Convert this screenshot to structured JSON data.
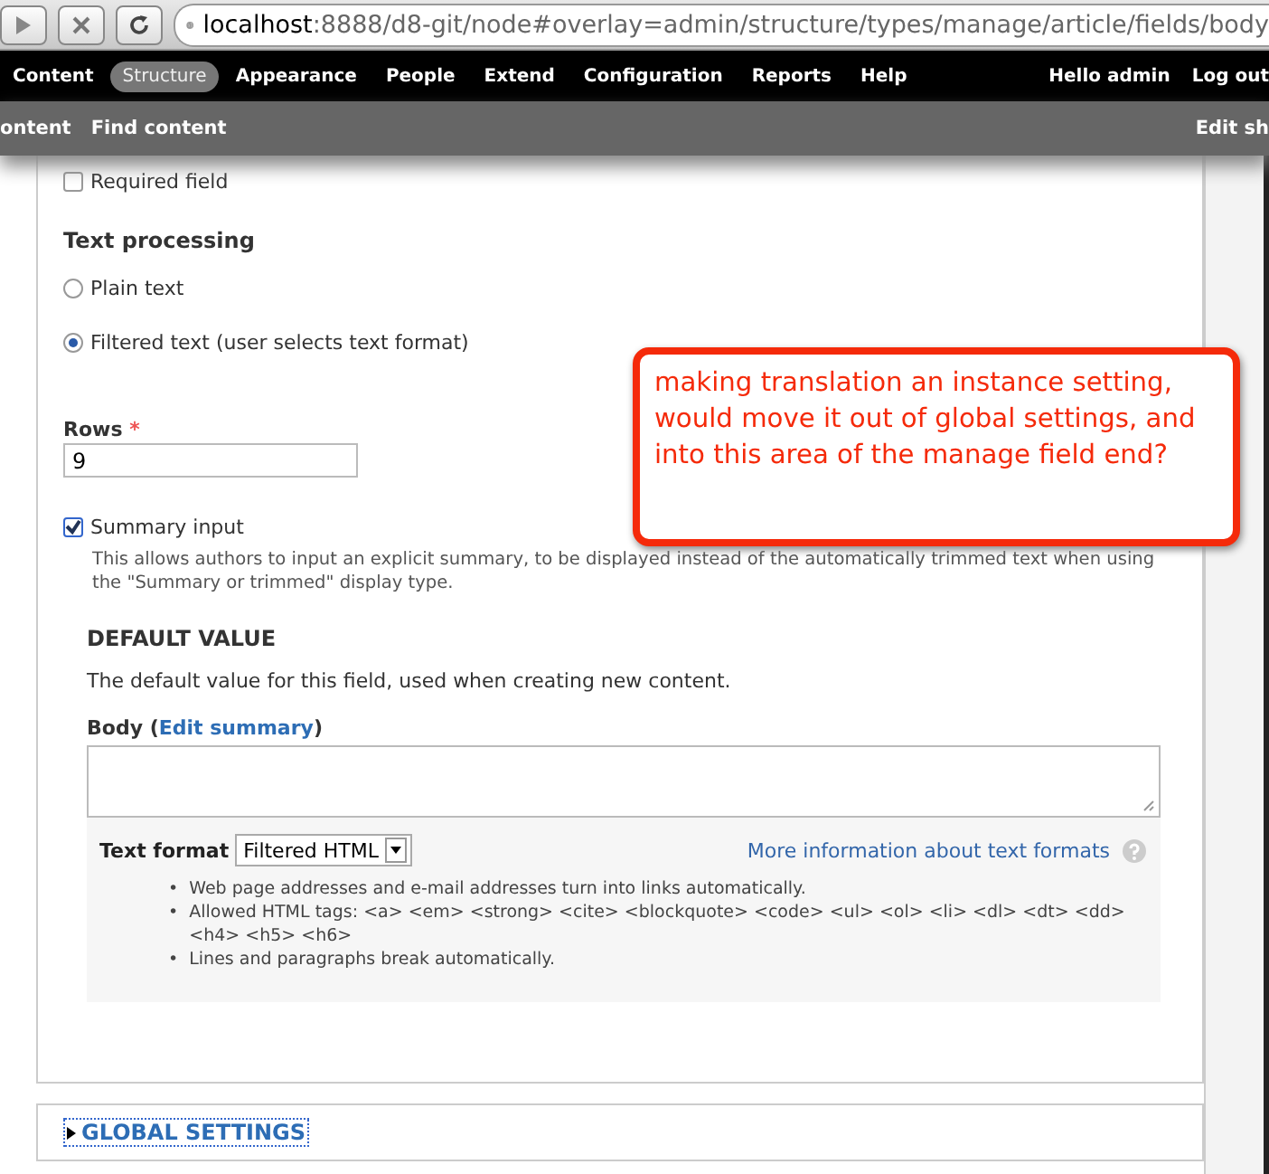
{
  "browser": {
    "url_host": "localhost",
    "url_rest": ":8888/d8-git/node#overlay=admin/structure/types/manage/article/fields/body"
  },
  "toolbar": {
    "items": [
      {
        "label": "Content",
        "selected": false
      },
      {
        "label": "Structure",
        "selected": true
      },
      {
        "label": "Appearance",
        "selected": false
      },
      {
        "label": "People",
        "selected": false
      },
      {
        "label": "Extend",
        "selected": false
      },
      {
        "label": "Configuration",
        "selected": false
      },
      {
        "label": "Reports",
        "selected": false
      },
      {
        "label": "Help",
        "selected": false
      }
    ],
    "greeting": "Hello",
    "user": "admin",
    "logout": "Log out"
  },
  "shortcuts": {
    "items": [
      "ontent",
      "Find content"
    ],
    "edit": "Edit sh"
  },
  "form": {
    "required": {
      "label": "Required field",
      "checked": false
    },
    "text_processing": {
      "title": "Text processing",
      "options": [
        {
          "label": "Plain text",
          "selected": false
        },
        {
          "label": "Filtered text (user selects text format)",
          "selected": true
        }
      ]
    },
    "rows": {
      "label": "Rows",
      "required_mark": "*",
      "value": "9"
    },
    "summary": {
      "label": "Summary input",
      "checked": true,
      "description": "This allows authors to input an explicit summary, to be displayed instead of the automatically trimmed text when using the \"Summary or trimmed\" display type."
    },
    "default_value": {
      "title": "DEFAULT VALUE",
      "description": "The default value for this field, used when creating new content.",
      "body_label": "Body",
      "paren_open": "(",
      "edit_summary": "Edit summary",
      "paren_close": ")",
      "bullet": "•",
      "format_label": "Text format",
      "format_value": "Filtered HTML",
      "more_info": "More information about text formats",
      "tips": [
        "Web page addresses and e-mail addresses turn into links automatically.",
        "Allowed HTML tags: <a> <em> <strong> <cite> <blockquote> <code> <ul> <ol> <li> <dl> <dt> <dd> <h4> <h5> <h6>",
        "Lines and paragraphs break automatically."
      ]
    }
  },
  "global_settings": {
    "label": "GLOBAL SETTINGS",
    "expanded": false
  },
  "annotation": {
    "text": "making translation an instance setting, would move it out of global settings, and into this area of the manage field end?"
  }
}
